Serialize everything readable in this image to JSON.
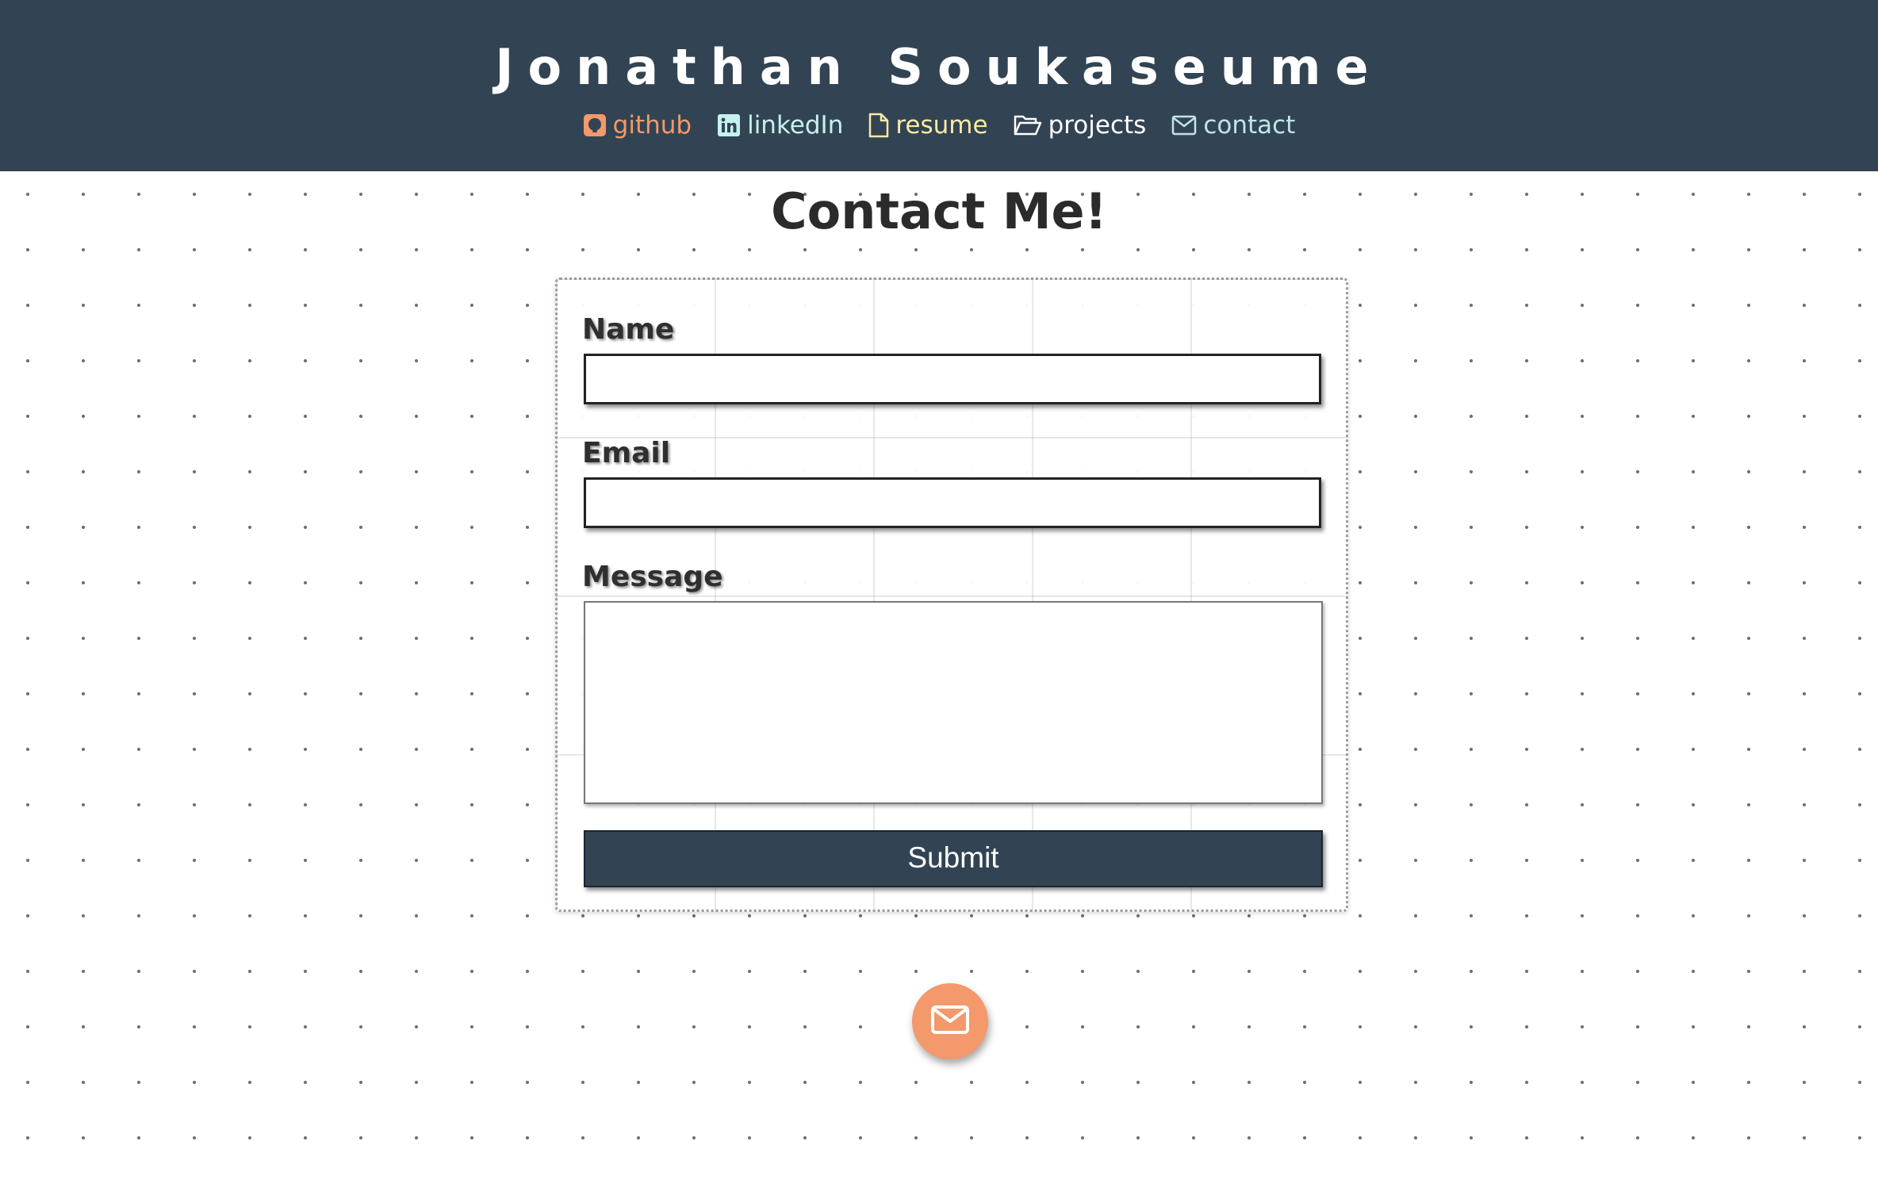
{
  "header": {
    "title": "Jonathan Soukaseume",
    "background": "#324453",
    "nav": [
      {
        "label": "github",
        "icon": "github-icon",
        "color": "#f3996b"
      },
      {
        "label": "linkedIn",
        "icon": "linkedin-icon",
        "color": "#c6f1ee"
      },
      {
        "label": "resume",
        "icon": "file-icon",
        "color": "#fbe9a6"
      },
      {
        "label": "projects",
        "icon": "folder-open-icon",
        "color": "#ffffff"
      },
      {
        "label": "contact",
        "icon": "envelope-icon",
        "color": "#bfe5e7"
      }
    ]
  },
  "main": {
    "heading": "Contact Me!",
    "form": {
      "name_label": "Name",
      "name_value": "",
      "email_label": "Email",
      "email_value": "",
      "message_label": "Message",
      "message_value": "",
      "submit_label": "Submit",
      "submit_color": "#324453"
    }
  },
  "fab": {
    "icon": "envelope-icon",
    "color": "#f3996b"
  }
}
